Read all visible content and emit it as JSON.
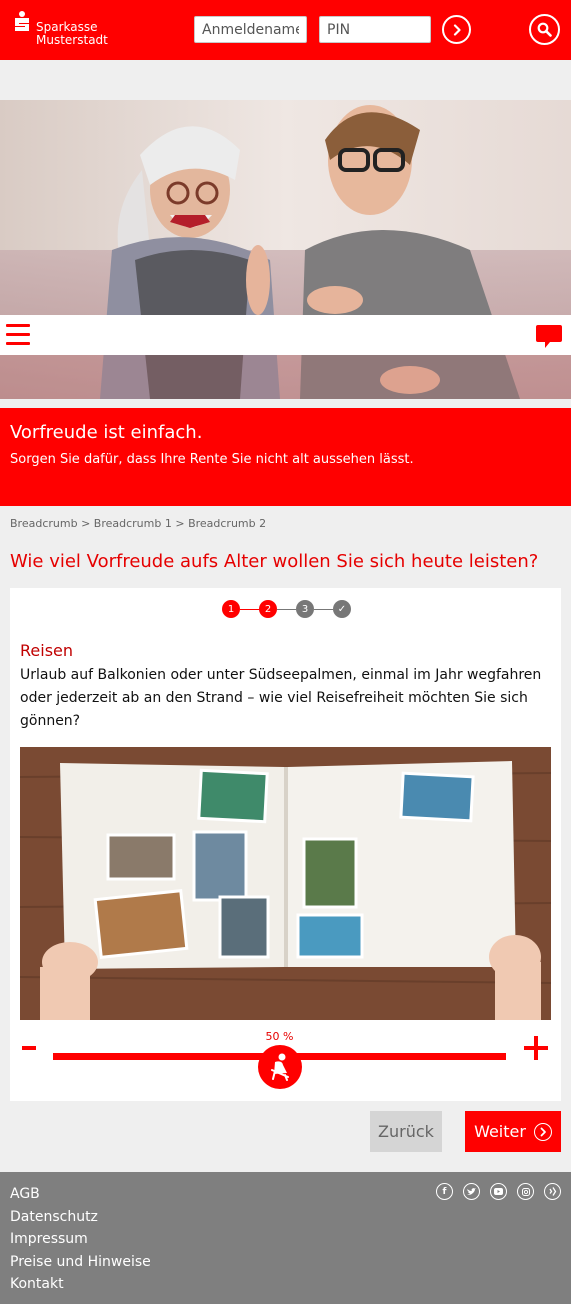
{
  "header": {
    "brand_line1": "Sparkasse",
    "brand_line2": "Musterstadt",
    "username_placeholder": "Anmeldename",
    "pin_placeholder": "PIN"
  },
  "promo": {
    "title": "Vorfreude ist einfach.",
    "subtitle": "Sorgen Sie dafür, dass Ihre Rente Sie nicht alt aussehen lässt."
  },
  "breadcrumb": {
    "items": [
      "Breadcrumb",
      "Breadcrumb 1",
      "Breadcrumb 2"
    ],
    "separator": ">"
  },
  "question": "Wie viel Vorfreude aufs Alter wollen Sie sich heute leisten?",
  "steps": {
    "items": [
      "1",
      "2",
      "3",
      "✓"
    ],
    "current": 2
  },
  "section": {
    "title": "Reisen",
    "text": "Urlaub auf Balkonien oder unter Südseepalmen, einmal im Jahr wegfahren oder jederzeit ab an den Strand – wie viel Reisefreiheit möchten Sie sich gönnen?"
  },
  "slider": {
    "value_label": "50 %",
    "value": 0.5,
    "minus": "-",
    "plus": "+"
  },
  "buttons": {
    "back": "Zurück",
    "next": "Weiter"
  },
  "footer": {
    "links": [
      "AGB",
      "Datenschutz",
      "Impressum",
      "Preise und Hinweise",
      "Kontakt"
    ],
    "social": [
      "facebook-icon",
      "twitter-icon",
      "youtube-icon",
      "instagram-icon",
      "xing-icon"
    ]
  },
  "colors": {
    "brand": "#ff0000",
    "heading": "#e60000",
    "step_inactive": "#777777",
    "footer": "#7f7f7f"
  }
}
